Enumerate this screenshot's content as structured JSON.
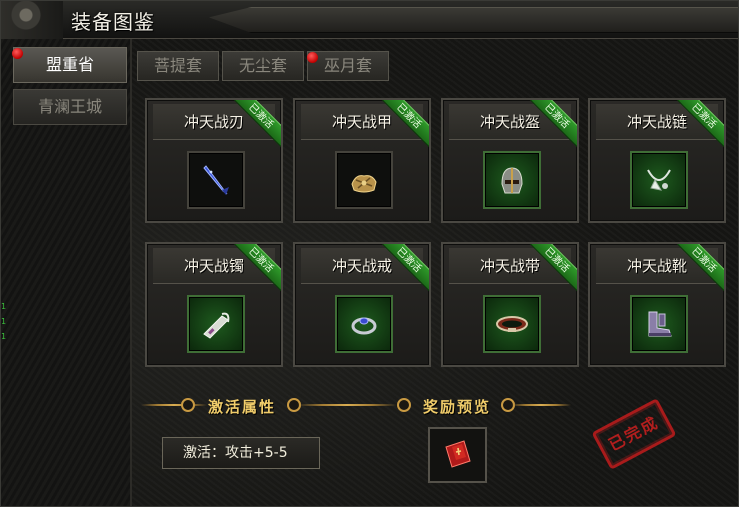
{
  "window": {
    "title": "装备图鉴"
  },
  "sidebar": {
    "tabs": [
      {
        "label": "盟重省",
        "active": true,
        "red_dot": true
      },
      {
        "label": "青澜王城",
        "active": false,
        "red_dot": false
      }
    ],
    "edge_marks": [
      "1",
      "1",
      "1"
    ]
  },
  "set_tabs": [
    {
      "label": "菩提套",
      "red_dot": false
    },
    {
      "label": "无尘套",
      "red_dot": false
    },
    {
      "label": "巫月套",
      "red_dot": true
    }
  ],
  "equipment": [
    {
      "name": "冲天战刃",
      "badge": "已激活",
      "icon": "blue-blade-icon"
    },
    {
      "name": "冲天战甲",
      "badge": "已激活",
      "icon": "gold-armor-icon"
    },
    {
      "name": "冲天战盔",
      "badge": "已激活",
      "icon": "helmet-icon"
    },
    {
      "name": "冲天战链",
      "badge": "已激活",
      "icon": "necklace-icon"
    },
    {
      "name": "冲天战镯",
      "badge": "已激活",
      "icon": "bracelet-icon"
    },
    {
      "name": "冲天战戒",
      "badge": "已激活",
      "icon": "ring-icon"
    },
    {
      "name": "冲天战带",
      "badge": "已激活",
      "icon": "belt-icon"
    },
    {
      "name": "冲天战靴",
      "badge": "已激活",
      "icon": "boots-icon"
    }
  ],
  "bottom": {
    "attr_heading": "激活属性",
    "reward_heading": "奖励预览",
    "attr_text": "激活：攻击+5-5",
    "reward_icon": "red-scroll-icon",
    "stamp": "已完成"
  },
  "colors": {
    "badge_green": "#2f9a2a",
    "heading_gold": "#f0cc6a",
    "stamp_red": "#c21f1f",
    "red_dot": "#c00000"
  }
}
